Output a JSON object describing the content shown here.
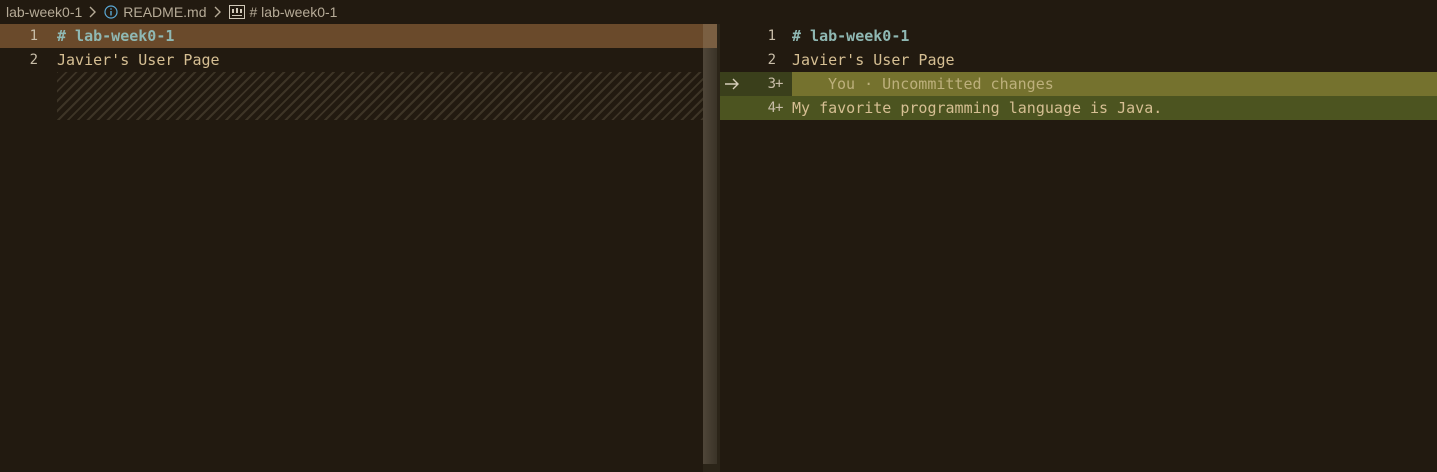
{
  "breadcrumb": {
    "folder": "lab-week0-1",
    "file": "README.md",
    "symbol": "# lab-week0-1",
    "info_icon": "info-icon",
    "symbol_icon": "abc-string-icon"
  },
  "left_editor": {
    "lines": [
      {
        "number": "1",
        "text": "# lab-week0-1"
      },
      {
        "number": "2",
        "text": "Javier's User Page"
      }
    ]
  },
  "right_editor": {
    "lines": [
      {
        "number": "1",
        "text": "# lab-week0-1"
      },
      {
        "number": "2",
        "text": "Javier's User Page"
      },
      {
        "number": "3",
        "marker": "+",
        "text": "",
        "blame": "You · Uncommitted changes"
      },
      {
        "number": "4",
        "marker": "+",
        "text": "My favorite programming language is Java."
      }
    ]
  },
  "colors": {
    "background": "#221a10",
    "heading": "#8fb8b3",
    "text": "#d6bf93",
    "modified_line": "#6a4a2b",
    "added_line": "#4c5420",
    "added_meta": "#75722e"
  }
}
